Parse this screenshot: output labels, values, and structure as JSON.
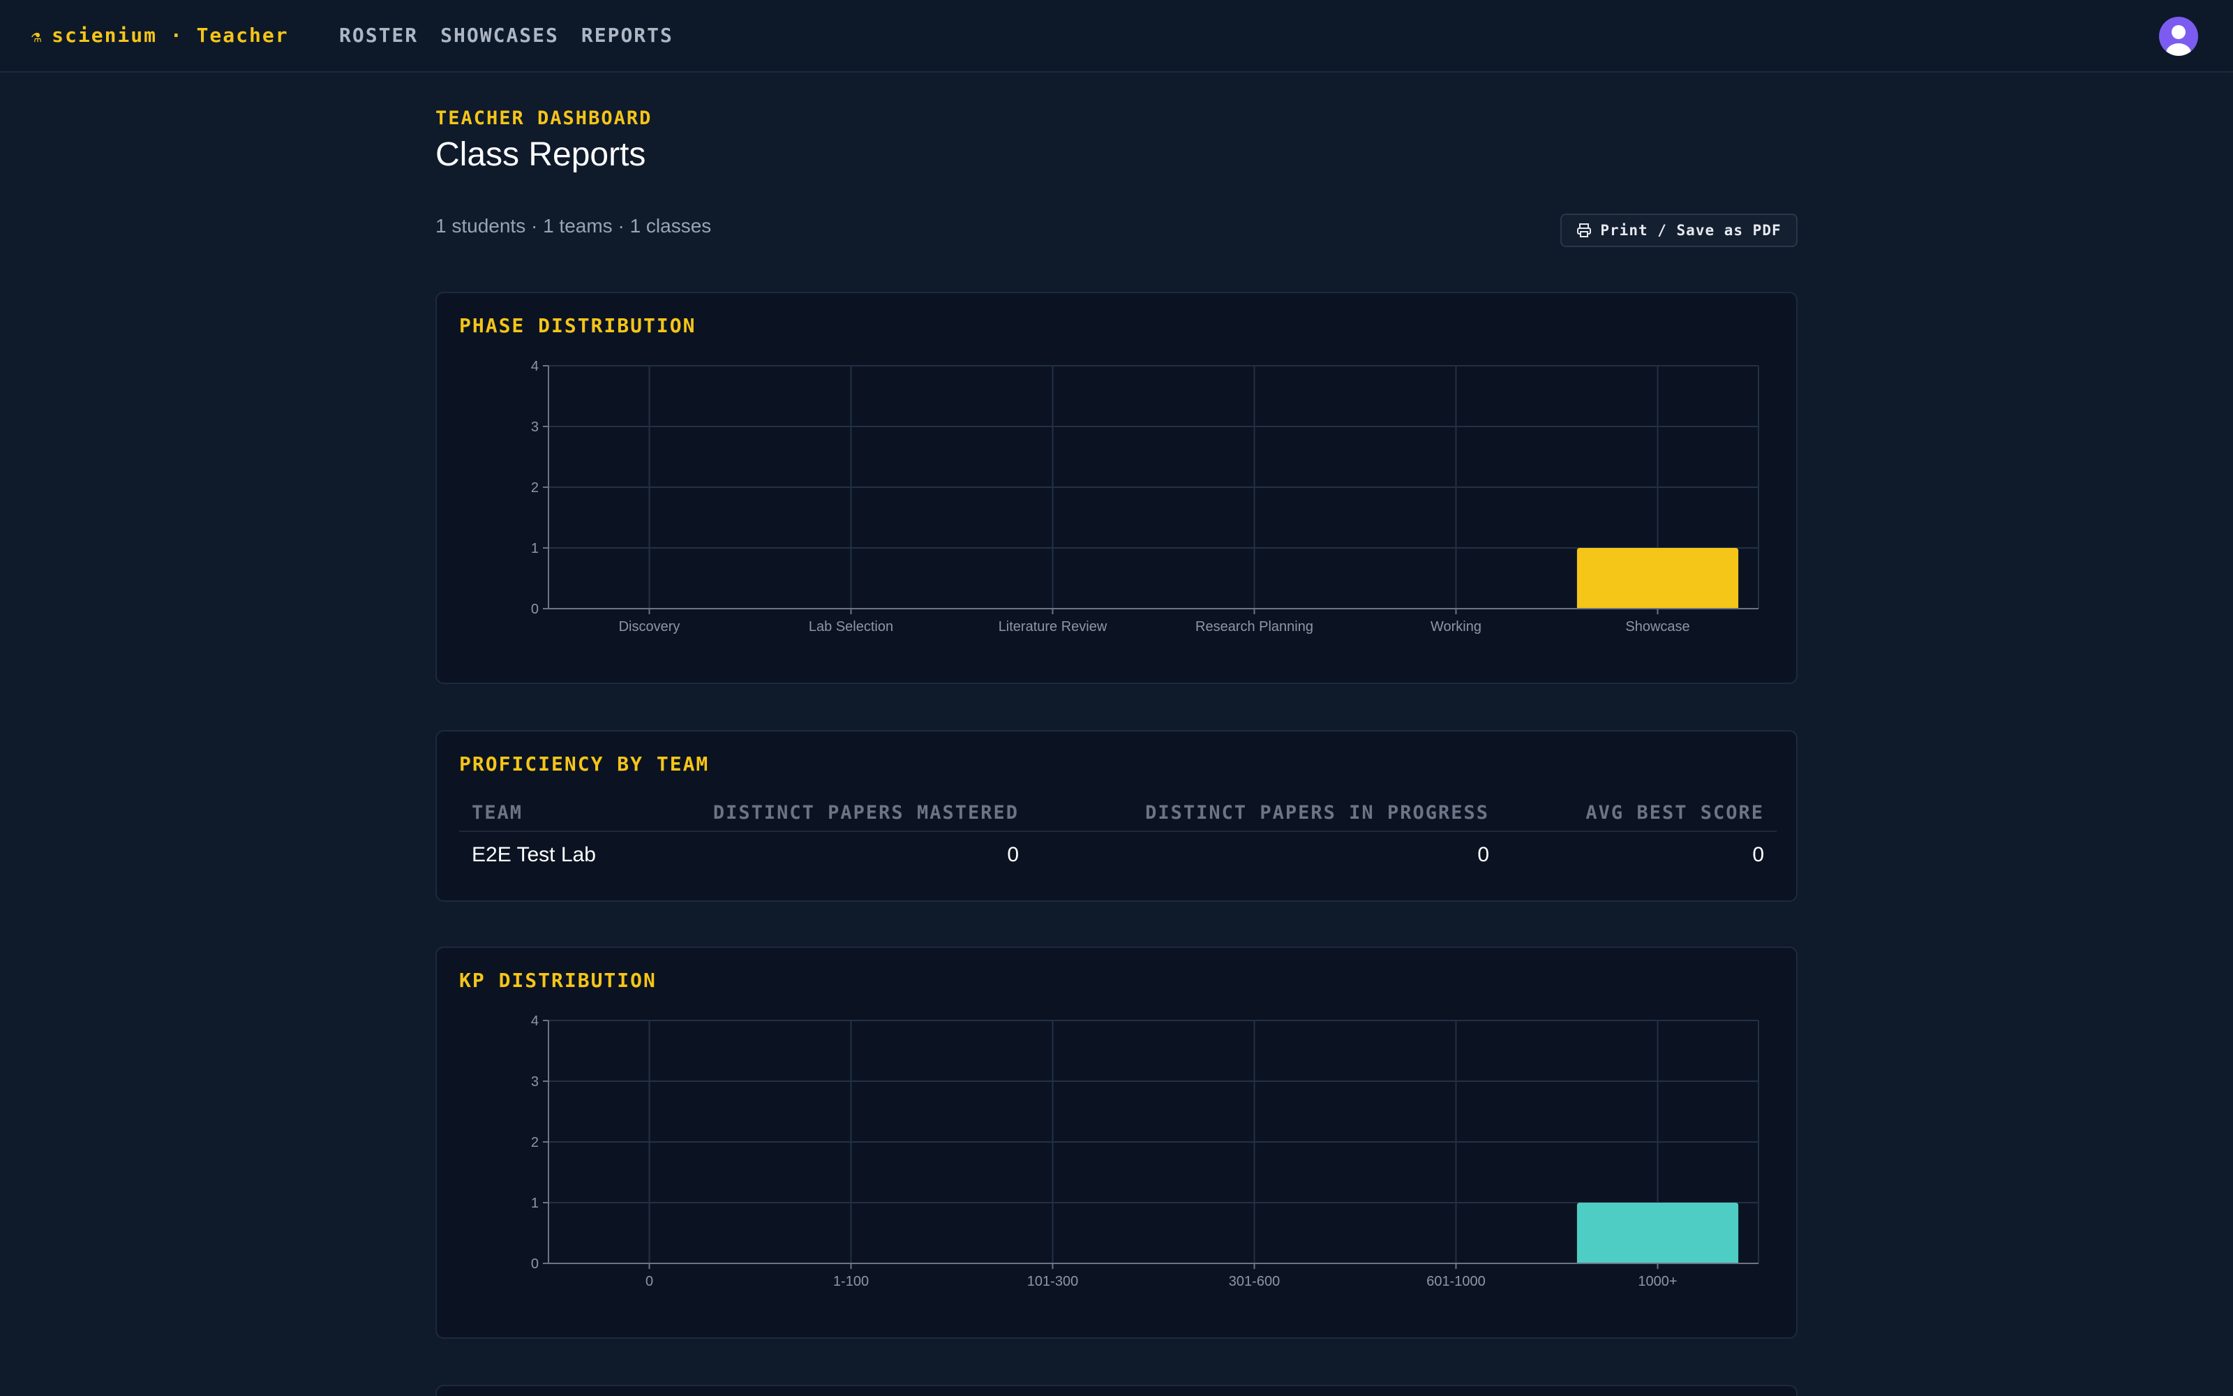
{
  "header": {
    "brand": "scienium · Teacher",
    "brand_icon": "flask-icon",
    "nav": [
      {
        "label": "ROSTER"
      },
      {
        "label": "SHOWCASES"
      },
      {
        "label": "REPORTS"
      }
    ],
    "avatar_icon": "user-avatar-icon"
  },
  "page": {
    "eyebrow": "TEACHER DASHBOARD",
    "title": "Class Reports",
    "summary": "1 students · 1 teams · 1 classes",
    "print_label": "Print / Save as PDF",
    "print_icon": "printer-icon"
  },
  "phase_card": {
    "title": "PHASE DISTRIBUTION"
  },
  "proficiency_card": {
    "title": "PROFICIENCY BY TEAM",
    "columns": [
      "TEAM",
      "DISTINCT PAPERS MASTERED",
      "DISTINCT PAPERS IN PROGRESS",
      "AVG BEST SCORE"
    ],
    "rows": [
      {
        "team": "E2E Test Lab",
        "mastered": "0",
        "in_progress": "0",
        "avg_best": "0"
      }
    ]
  },
  "kp_card": {
    "title": "KP DISTRIBUTION"
  },
  "colors": {
    "accent": "#f5c518",
    "teal": "#4ecdc4",
    "background": "#0f1a2b"
  },
  "chart_data": [
    {
      "type": "bar",
      "title": "PHASE DISTRIBUTION",
      "categories": [
        "Discovery",
        "Lab Selection",
        "Literature Review",
        "Research Planning",
        "Working",
        "Showcase"
      ],
      "values": [
        0,
        0,
        0,
        0,
        0,
        1
      ],
      "yticks": [
        0,
        1,
        2,
        3,
        4
      ],
      "ylim": [
        0,
        4
      ],
      "grid": true,
      "color": "#f5c518"
    },
    {
      "type": "bar",
      "title": "KP DISTRIBUTION",
      "categories": [
        "0",
        "1-100",
        "101-300",
        "301-600",
        "601-1000",
        "1000+"
      ],
      "values": [
        0,
        0,
        0,
        0,
        0,
        1
      ],
      "yticks": [
        0,
        1,
        2,
        3,
        4
      ],
      "ylim": [
        0,
        4
      ],
      "grid": true,
      "color": "#4ecdc4"
    }
  ]
}
